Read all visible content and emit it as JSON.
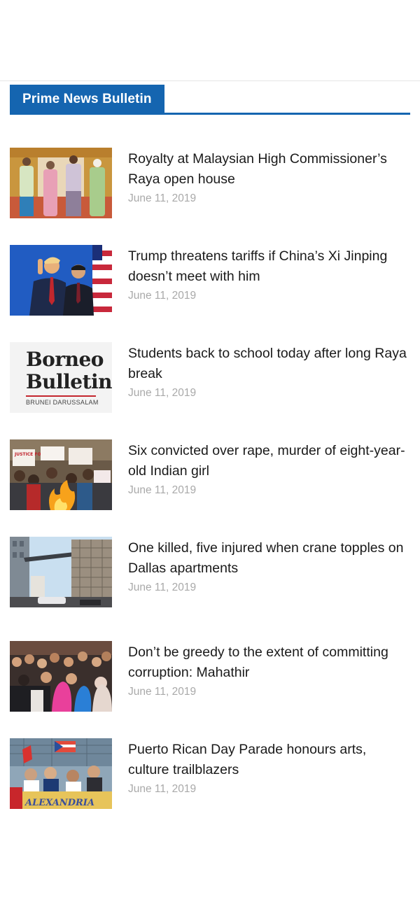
{
  "section": {
    "title": "Prime News Bulletin"
  },
  "news": [
    {
      "headline": "Royalty at Malaysian High Commissioner’s Raya open house",
      "date": "June 11, 2019"
    },
    {
      "headline": "Trump threatens tariffs if China’s Xi Jinping doesn’t meet with him",
      "date": "June 11, 2019"
    },
    {
      "headline": "Students back to school today after long Raya break",
      "date": "June 11, 2019"
    },
    {
      "headline": "Six convicted over rape, murder of eight-year-old Indian girl",
      "date": "June 11, 2019"
    },
    {
      "headline": "One killed, five injured when crane topples on Dallas apartments",
      "date": "June 11, 2019"
    },
    {
      "headline": "Don’t be greedy to the extent of committing corruption: Mahathir",
      "date": "June 11, 2019"
    },
    {
      "headline": "Puerto Rican Day Parade honours arts, culture trailblazers",
      "date": "June 11, 2019"
    }
  ],
  "logo": {
    "line1": "Borneo",
    "line2": "Bulletin",
    "sub": "BRUNEI DARUSSALAM"
  },
  "photo_text": {
    "protest_sign": "JUSTICE FOR ASIFA",
    "parade_banner": "ALEXANDRIA"
  }
}
